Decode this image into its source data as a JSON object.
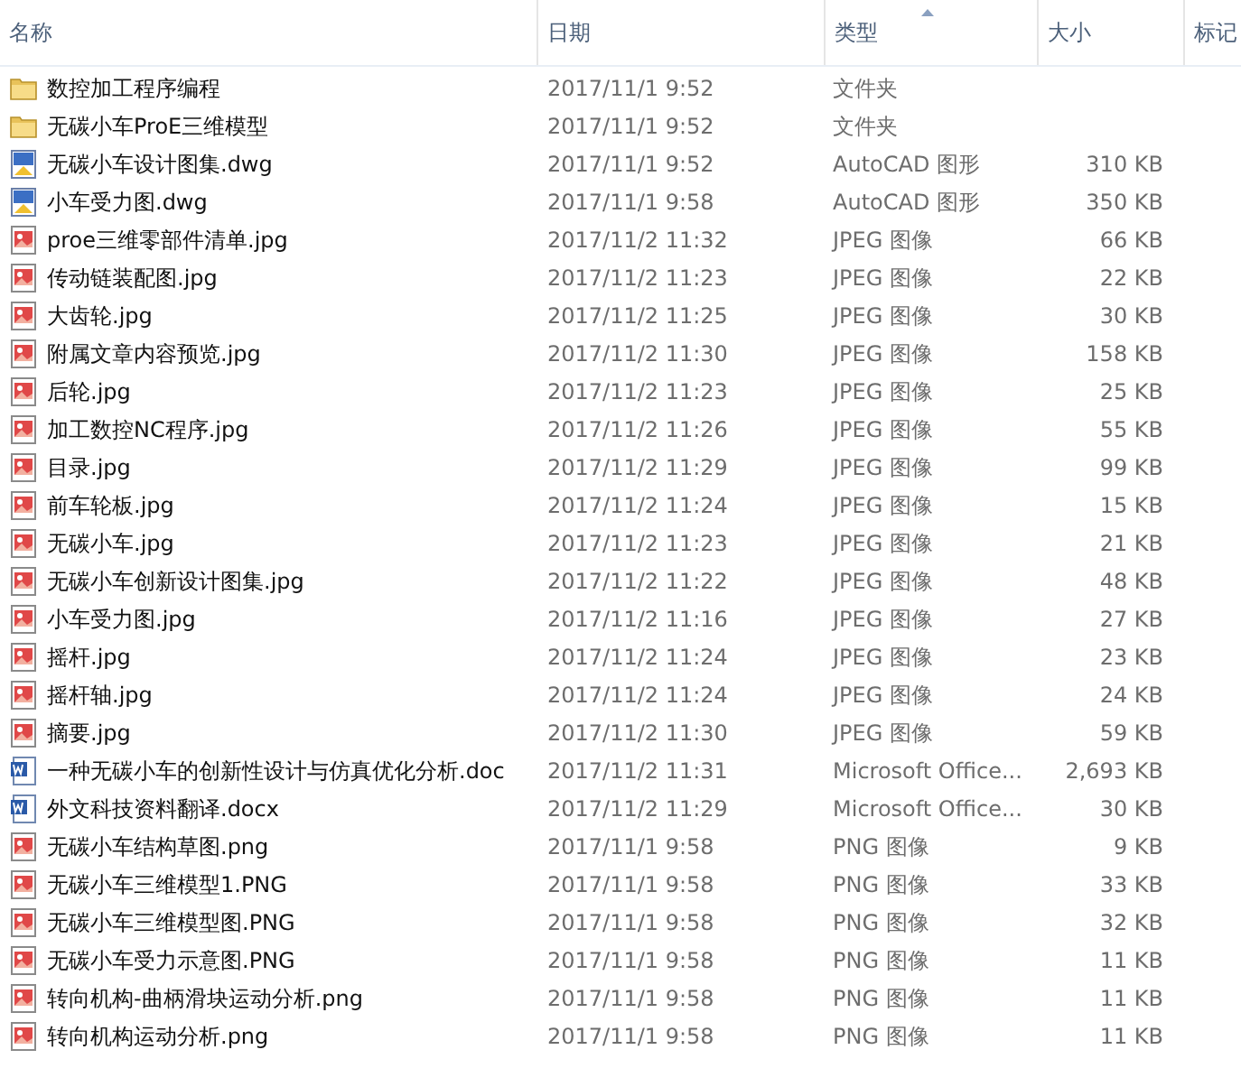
{
  "columns": [
    {
      "label": "名称",
      "sorted": false
    },
    {
      "label": "日期",
      "sorted": false
    },
    {
      "label": "类型",
      "sorted": true
    },
    {
      "label": "大小",
      "sorted": false
    },
    {
      "label": "标记",
      "sorted": false
    }
  ],
  "rows": [
    {
      "kind": "folder",
      "name": "数控加工程序编程",
      "date": "2017/11/1 9:52",
      "type": "文件夹"
    },
    {
      "kind": "folder",
      "name": "无碳小车ProE三维模型",
      "date": "2017/11/1 9:52",
      "type": "文件夹"
    },
    {
      "kind": "cad",
      "name": "无碳小车设计图集.dwg",
      "date": "2017/11/1 9:52",
      "type": "AutoCAD 图形",
      "size": "310 KB"
    },
    {
      "kind": "cad",
      "name": "小车受力图.dwg",
      "date": "2017/11/1 9:58",
      "type": "AutoCAD 图形",
      "size": "350 KB"
    },
    {
      "kind": "image",
      "name": "proe三维零部件清单.jpg",
      "date": "2017/11/2 11:32",
      "type": "JPEG 图像",
      "size": "66 KB"
    },
    {
      "kind": "image",
      "name": "传动链装配图.jpg",
      "date": "2017/11/2 11:23",
      "type": "JPEG 图像",
      "size": "22 KB"
    },
    {
      "kind": "image",
      "name": "大齿轮.jpg",
      "date": "2017/11/2 11:25",
      "type": "JPEG 图像",
      "size": "30 KB"
    },
    {
      "kind": "image",
      "name": "附属文章内容预览.jpg",
      "date": "2017/11/2 11:30",
      "type": "JPEG 图像",
      "size": "158 KB"
    },
    {
      "kind": "image",
      "name": "后轮.jpg",
      "date": "2017/11/2 11:23",
      "type": "JPEG 图像",
      "size": "25 KB"
    },
    {
      "kind": "image",
      "name": "加工数控NC程序.jpg",
      "date": "2017/11/2 11:26",
      "type": "JPEG 图像",
      "size": "55 KB"
    },
    {
      "kind": "image",
      "name": "目录.jpg",
      "date": "2017/11/2 11:29",
      "type": "JPEG 图像",
      "size": "99 KB"
    },
    {
      "kind": "image",
      "name": "前车轮板.jpg",
      "date": "2017/11/2 11:24",
      "type": "JPEG 图像",
      "size": "15 KB"
    },
    {
      "kind": "image",
      "name": "无碳小车.jpg",
      "date": "2017/11/2 11:23",
      "type": "JPEG 图像",
      "size": "21 KB"
    },
    {
      "kind": "image",
      "name": "无碳小车创新设计图集.jpg",
      "date": "2017/11/2 11:22",
      "type": "JPEG 图像",
      "size": "48 KB"
    },
    {
      "kind": "image",
      "name": "小车受力图.jpg",
      "date": "2017/11/2 11:16",
      "type": "JPEG 图像",
      "size": "27 KB"
    },
    {
      "kind": "image",
      "name": "摇杆.jpg",
      "date": "2017/11/2 11:24",
      "type": "JPEG 图像",
      "size": "23 KB"
    },
    {
      "kind": "image",
      "name": "摇杆轴.jpg",
      "date": "2017/11/2 11:24",
      "type": "JPEG 图像",
      "size": "24 KB"
    },
    {
      "kind": "image",
      "name": "摘要.jpg",
      "date": "2017/11/2 11:30",
      "type": "JPEG 图像",
      "size": "59 KB"
    },
    {
      "kind": "word",
      "name": "一种无碳小车的创新性设计与仿真优化分析.doc",
      "date": "2017/11/2 11:31",
      "type": "Microsoft Office...",
      "size": "2,693 KB"
    },
    {
      "kind": "word",
      "name": "外文科技资料翻译.docx",
      "date": "2017/11/2 11:29",
      "type": "Microsoft Office...",
      "size": "30 KB"
    },
    {
      "kind": "image",
      "name": "无碳小车结构草图.png",
      "date": "2017/11/1 9:58",
      "type": "PNG 图像",
      "size": "9 KB"
    },
    {
      "kind": "image",
      "name": "无碳小车三维模型1.PNG",
      "date": "2017/11/1 9:58",
      "type": "PNG 图像",
      "size": "33 KB"
    },
    {
      "kind": "image",
      "name": "无碳小车三维模型图.PNG",
      "date": "2017/11/1 9:58",
      "type": "PNG 图像",
      "size": "32 KB"
    },
    {
      "kind": "image",
      "name": "无碳小车受力示意图.PNG",
      "date": "2017/11/1 9:58",
      "type": "PNG 图像",
      "size": "11 KB"
    },
    {
      "kind": "image",
      "name": "转向机构-曲柄滑块运动分析.png",
      "date": "2017/11/1 9:58",
      "type": "PNG 图像",
      "size": "11 KB"
    },
    {
      "kind": "image",
      "name": "转向机构运动分析.png",
      "date": "2017/11/1 9:58",
      "type": "PNG 图像",
      "size": "11 KB"
    }
  ]
}
